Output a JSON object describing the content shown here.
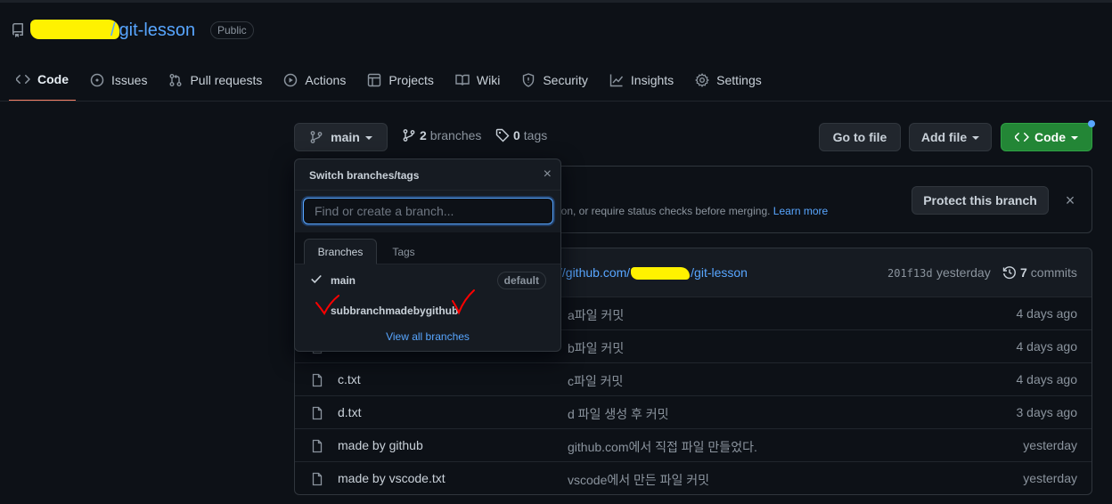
{
  "repo": {
    "name": "git-lesson",
    "separator": "/",
    "visibility": "Public"
  },
  "tabs": [
    {
      "label": "Code",
      "icon": "code-icon",
      "active": true
    },
    {
      "label": "Issues",
      "icon": "issue-icon"
    },
    {
      "label": "Pull requests",
      "icon": "pull-request-icon"
    },
    {
      "label": "Actions",
      "icon": "play-icon"
    },
    {
      "label": "Projects",
      "icon": "table-icon"
    },
    {
      "label": "Wiki",
      "icon": "book-icon"
    },
    {
      "label": "Security",
      "icon": "shield-icon"
    },
    {
      "label": "Insights",
      "icon": "graph-icon"
    },
    {
      "label": "Settings",
      "icon": "gear-icon"
    }
  ],
  "branch_bar": {
    "current_branch": "main",
    "branches_count": "2",
    "branches_label": "branches",
    "tags_count": "0",
    "tags_label": "tags",
    "goto_file": "Go to file",
    "add_file": "Add file",
    "code": "Code"
  },
  "banner": {
    "text": "ion, or require status checks before merging.",
    "link": "Learn more",
    "protect_button": "Protect this branch",
    "close": "×"
  },
  "latest_commit": {
    "message_prefix": "//github.com/",
    "message_suffix": "/git-lesson",
    "hash": "201f13d",
    "time": "yesterday",
    "commits_count": "7",
    "commits_label": "commits"
  },
  "files": [
    {
      "name": "",
      "message": "a파일 커밋",
      "time": "4 days ago"
    },
    {
      "name": "",
      "message": "b파일 커밋",
      "time": "4 days ago"
    },
    {
      "name": "c.txt",
      "message": "c파일 커밋",
      "time": "4 days ago"
    },
    {
      "name": "d.txt",
      "message": "d 파일 생성 후 커밋",
      "time": "3 days ago"
    },
    {
      "name": "made by github",
      "message": "github.com에서 직접 파일 만들었다.",
      "time": "yesterday"
    },
    {
      "name": "made by vscode.txt",
      "message": "vscode에서 만든 파일 커밋",
      "time": "yesterday"
    }
  ],
  "dropdown": {
    "title": "Switch branches/tags",
    "close": "×",
    "filter_placeholder": "Find or create a branch...",
    "tab_branches": "Branches",
    "tab_tags": "Tags",
    "branches": [
      {
        "name": "main",
        "badge": "default",
        "selected": true
      },
      {
        "name": "subbranchmadebygithub",
        "badge": "",
        "selected": false
      }
    ],
    "view_all": "View all branches"
  },
  "colors": {
    "background": "#0d1117",
    "accent_blue": "#58a6ff",
    "green_button": "#238636",
    "tab_underline": "#f78166",
    "highlighter": "#fff200",
    "annotation_red": "#ff0000"
  }
}
